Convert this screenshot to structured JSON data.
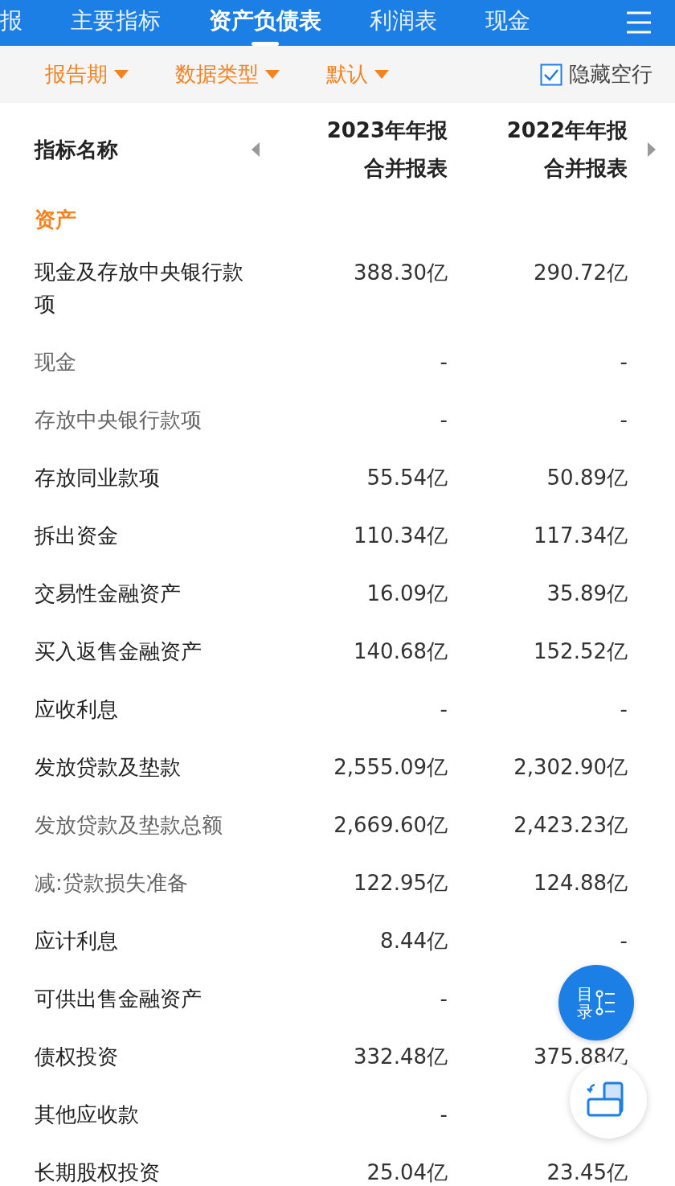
{
  "tabs": [
    {
      "label": "报",
      "selected": false
    },
    {
      "label": "主要指标",
      "selected": false
    },
    {
      "label": "资产负债表",
      "selected": true
    },
    {
      "label": "利润表",
      "selected": false
    },
    {
      "label": "现金",
      "selected": false
    }
  ],
  "filters": [
    {
      "label": "报告期"
    },
    {
      "label": "数据类型"
    },
    {
      "label": "默认"
    }
  ],
  "hide_empty_rows": {
    "label": "隐藏空行",
    "checked": true
  },
  "table": {
    "name_header": "指标名称",
    "columns": [
      {
        "year": "2023年年报",
        "type": "合并报表"
      },
      {
        "year": "2022年年报",
        "type": "合并报表"
      }
    ],
    "sections": [
      {
        "title": "资产",
        "rows": [
          {
            "name": "现金及存放中央银行款项",
            "sub": false,
            "values": [
              "388.30亿",
              "290.72亿"
            ]
          },
          {
            "name": "现金",
            "sub": true,
            "values": [
              "-",
              "-"
            ]
          },
          {
            "name": "存放中央银行款项",
            "sub": true,
            "values": [
              "-",
              "-"
            ]
          },
          {
            "name": "存放同业款项",
            "sub": false,
            "values": [
              "55.54亿",
              "50.89亿"
            ]
          },
          {
            "name": "拆出资金",
            "sub": false,
            "values": [
              "110.34亿",
              "117.34亿"
            ]
          },
          {
            "name": "交易性金融资产",
            "sub": false,
            "values": [
              "16.09亿",
              "35.89亿"
            ]
          },
          {
            "name": "买入返售金融资产",
            "sub": false,
            "values": [
              "140.68亿",
              "152.52亿"
            ]
          },
          {
            "name": "应收利息",
            "sub": false,
            "values": [
              "-",
              "-"
            ]
          },
          {
            "name": "发放贷款及垫款",
            "sub": false,
            "values": [
              "2,555.09亿",
              "2,302.90亿"
            ]
          },
          {
            "name": "发放贷款及垫款总额",
            "sub": true,
            "values": [
              "2,669.60亿",
              "2,423.23亿"
            ]
          },
          {
            "name": "减:贷款损失准备",
            "sub": true,
            "values": [
              "122.95亿",
              "124.88亿"
            ]
          },
          {
            "name": "应计利息",
            "sub": false,
            "values": [
              "8.44亿",
              "-"
            ]
          },
          {
            "name": "可供出售金融资产",
            "sub": false,
            "values": [
              "-"
            ]
          },
          {
            "name": "债权投资",
            "sub": false,
            "values": [
              "332.48亿",
              "375.88亿"
            ]
          },
          {
            "name": "其他应收款",
            "sub": false,
            "values": [
              "-"
            ]
          },
          {
            "name": "长期股权投资",
            "sub": false,
            "values": [
              "25.04亿",
              "23.45亿"
            ]
          }
        ]
      }
    ]
  },
  "catalog_button": {
    "label": "目录"
  }
}
